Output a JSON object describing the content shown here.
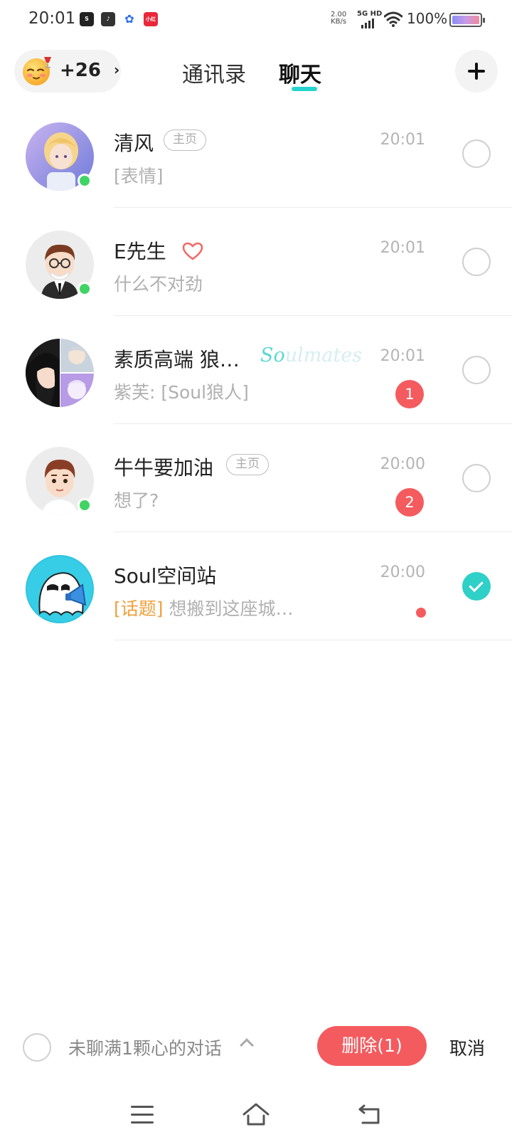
{
  "status_bar": {
    "time": "20:01",
    "apps": [
      "Soul",
      "TikTok",
      "Baidu",
      "Xiaohongshu"
    ],
    "net_speed_top": "2.00",
    "net_speed_unit": "KB/s",
    "signal_label": "5G HD",
    "battery_percent": "100%"
  },
  "header": {
    "mood_count": "+26",
    "tabs": [
      {
        "label": "通讯录",
        "active": false
      },
      {
        "label": "聊天",
        "active": true
      }
    ],
    "accent_color": "#25d4d0"
  },
  "chats": [
    {
      "name": "清风",
      "tag": "主页",
      "time": "20:01",
      "preview": "[表情]",
      "online": true,
      "checked": false
    },
    {
      "name": "E先生",
      "tag": "",
      "heart": true,
      "time": "20:01",
      "preview": "什么不对劲",
      "online": true,
      "checked": false
    },
    {
      "name": "素质高端 狼…",
      "watermark_a": "So",
      "watermark_b": "ulmates",
      "time": "20:01",
      "preview": "紫芙: [Soul狼人]",
      "badge": "1",
      "online": false,
      "checked": false
    },
    {
      "name": "牛牛要加油",
      "tag": "主页",
      "time": "20:00",
      "preview": "想了?",
      "badge": "2",
      "online": true,
      "checked": false
    },
    {
      "name": "Soul空间站",
      "time": "20:00",
      "preview_topic": "[话题]",
      "preview": "想搬到这座城…",
      "red_dot": true,
      "online": false,
      "checked": true
    }
  ],
  "bottom_bar": {
    "filter_label": "未聊满1颗心的对话",
    "delete_label": "删除(1)",
    "cancel_label": "取消"
  },
  "colors": {
    "badge": "#f45b5f",
    "online": "#3fd464",
    "topic": "#f0a03c"
  }
}
